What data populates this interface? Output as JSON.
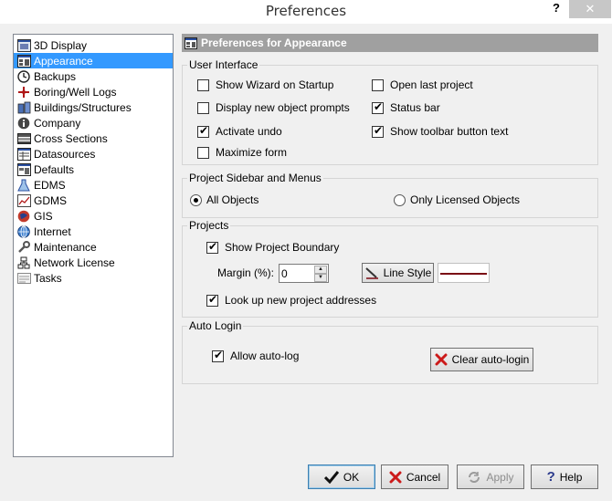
{
  "window": {
    "title": "Preferences",
    "help_glyph": "?",
    "close_glyph": "✕"
  },
  "nav": {
    "items": [
      {
        "label": "3D Display",
        "icon": "3d-display-icon"
      },
      {
        "label": "Appearance",
        "icon": "appearance-icon",
        "selected": true
      },
      {
        "label": "Backups",
        "icon": "clock-icon"
      },
      {
        "label": "Boring/Well Logs",
        "icon": "boring-icon"
      },
      {
        "label": "Buildings/Structures",
        "icon": "buildings-icon"
      },
      {
        "label": "Company",
        "icon": "info-icon"
      },
      {
        "label": "Cross Sections",
        "icon": "cross-sections-icon"
      },
      {
        "label": "Datasources",
        "icon": "datasources-icon"
      },
      {
        "label": "Defaults",
        "icon": "defaults-icon"
      },
      {
        "label": "EDMS",
        "icon": "flask-icon"
      },
      {
        "label": "GDMS",
        "icon": "chart-icon"
      },
      {
        "label": "GIS",
        "icon": "globe-icon"
      },
      {
        "label": "Internet",
        "icon": "internet-icon"
      },
      {
        "label": "Maintenance",
        "icon": "wrench-icon"
      },
      {
        "label": "Network License",
        "icon": "network-icon"
      },
      {
        "label": "Tasks",
        "icon": "tasks-icon"
      }
    ]
  },
  "pane": {
    "header": "Preferences for Appearance"
  },
  "user_interface": {
    "title": "User Interface",
    "show_wizard": {
      "label": "Show Wizard on Startup",
      "checked": false
    },
    "open_last_project": {
      "label": "Open last project",
      "checked": false
    },
    "display_new_object_prompts": {
      "label": "Display new object prompts",
      "checked": false
    },
    "status_bar": {
      "label": "Status bar",
      "checked": true
    },
    "activate_undo": {
      "label": "Activate undo",
      "checked": true
    },
    "show_toolbar_text": {
      "label": "Show toolbar button text",
      "checked": true
    },
    "maximize_form": {
      "label": "Maximize form",
      "checked": false
    }
  },
  "sidebar_menus": {
    "title": "Project Sidebar and Menus",
    "all_objects": {
      "label": "All Objects",
      "selected": true
    },
    "licensed_objects": {
      "label": "Only Licensed Objects",
      "selected": false
    }
  },
  "projects": {
    "title": "Projects",
    "show_boundary": {
      "label": "Show Project Boundary",
      "checked": true
    },
    "margin_label": "Margin (%):",
    "margin_value": "0",
    "line_style_label": "Line Style",
    "line_color": "#7a0a14",
    "lookup_addresses": {
      "label": "Look up new project addresses",
      "checked": true
    }
  },
  "auto_login": {
    "title": "Auto Login",
    "allow": {
      "label": "Allow auto-log",
      "checked": true
    },
    "clear_label": "Clear auto-login"
  },
  "footer": {
    "ok": "OK",
    "cancel": "Cancel",
    "apply": "Apply",
    "help": "Help"
  }
}
